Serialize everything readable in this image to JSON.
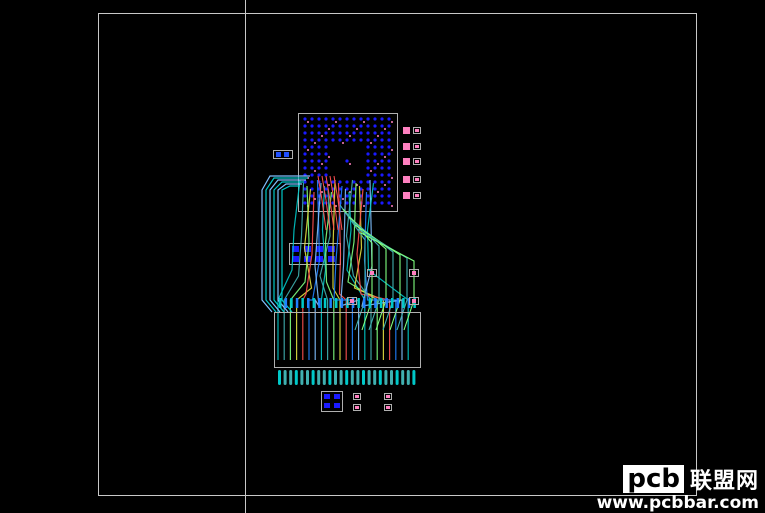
{
  "colors": {
    "background": "#000000",
    "board_outline": "#c8c8c8",
    "pad_pink": "#ff80c0",
    "via_blue": "#1a1aff",
    "trace_cyan": "#00c8c8",
    "trace_teal": "#40b0b0",
    "trace_green": "#80ff80",
    "trace_yellow": "#e0e040",
    "trace_red": "#ff5050",
    "trace_blue": "#2080ff",
    "trace_lightblue": "#80c0ff"
  },
  "icons": {
    "via": "filled-dot",
    "pad": "filled-square"
  },
  "watermark": {
    "logo_text": "pcb",
    "chinese_text": "联盟网",
    "url_text": "www.pcbbar.com"
  }
}
